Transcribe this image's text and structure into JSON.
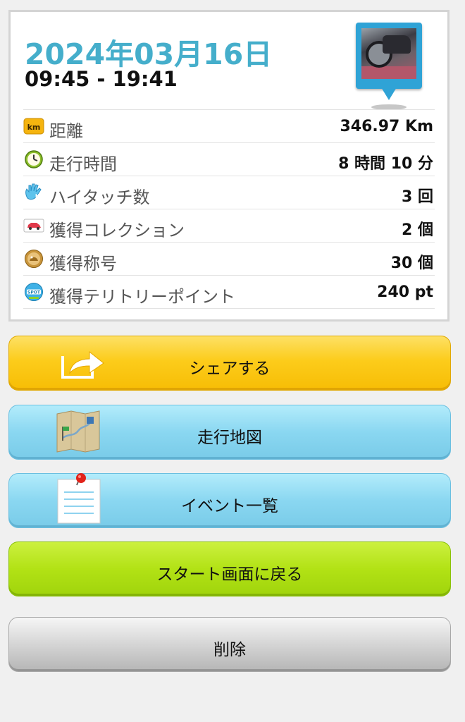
{
  "summary": {
    "date": "2024年03月16日",
    "time_range": "09:45 - 19:41"
  },
  "stats": [
    {
      "icon": "km-badge-icon",
      "label": "距離",
      "value": "346.97 Km"
    },
    {
      "icon": "clock-icon",
      "label": "走行時間",
      "value": "8 時間 10 分"
    },
    {
      "icon": "high-five-hand-icon",
      "label": "ハイタッチ数",
      "value": "3 回"
    },
    {
      "icon": "car-collection-icon",
      "label": "獲得コレクション",
      "value": "2 個"
    },
    {
      "icon": "title-medal-icon",
      "label": "獲得称号",
      "value": "30 個"
    },
    {
      "icon": "spot-badge-icon",
      "label": "獲得テリトリーポイント",
      "value": "240 pt"
    }
  ],
  "buttons": {
    "share": "シェアする",
    "map": "走行地図",
    "events": "イベント一覧",
    "start": "スタート画面に戻る",
    "delete": "削除"
  },
  "icon_labels": {
    "km": "km",
    "spot": "SPOT"
  },
  "colors": {
    "date_accent": "#45aecb",
    "share_button": "#fccc1b",
    "map_button": "#8ad7f1",
    "start_button": "#b2e215",
    "delete_button": "#d8d8d8"
  }
}
